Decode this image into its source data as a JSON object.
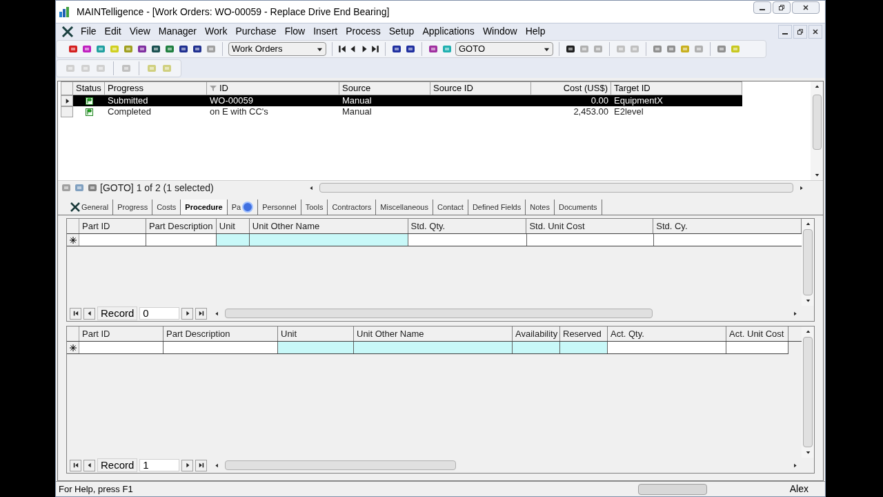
{
  "window": {
    "title": "MAINTelligence - [Work Orders: WO-00059 - Replace Drive End Bearing]"
  },
  "menu": [
    "File",
    "Edit",
    "View",
    "Manager",
    "Work",
    "Purchase",
    "Flow",
    "Insert",
    "Process",
    "Setup",
    "Applications",
    "Window",
    "Help"
  ],
  "toolbar": {
    "module_dropdown": "Work Orders",
    "goto_dropdown": "GOTO"
  },
  "work_orders": {
    "columns": [
      {
        "label": "Status",
        "filtered": false
      },
      {
        "label": "Progress",
        "filtered": false
      },
      {
        "label": "ID",
        "filtered": true
      },
      {
        "label": "Source",
        "filtered": false
      },
      {
        "label": "Source ID",
        "filtered": false
      },
      {
        "label": "Cost (US$)",
        "filtered": false
      },
      {
        "label": "Target ID",
        "filtered": false
      }
    ],
    "rows": [
      {
        "selected": true,
        "progress": "Submitted",
        "id": "WO-00059",
        "source": "Manual",
        "cost": "0.00",
        "target_id": "EquipmentX"
      },
      {
        "selected": false,
        "progress": "Completed",
        "id": "on E with CC's",
        "source": "Manual",
        "cost": "2,453.00",
        "target_id": "E2level"
      }
    ],
    "status": "[GOTO] 1 of 2 (1 selected)"
  },
  "tabs": [
    {
      "label": "General",
      "selected": false
    },
    {
      "label": "Progress",
      "selected": false
    },
    {
      "label": "Costs",
      "selected": false
    },
    {
      "label": "Procedure",
      "selected": true
    },
    {
      "label": "Pa",
      "selected": false
    },
    {
      "label": "Personnel",
      "selected": false
    },
    {
      "label": "Tools",
      "selected": false
    },
    {
      "label": "Contractors",
      "selected": false
    },
    {
      "label": "Miscellaneous",
      "selected": false
    },
    {
      "label": "Contact",
      "selected": false
    },
    {
      "label": "Defined Fields",
      "selected": false
    },
    {
      "label": "Notes",
      "selected": false
    },
    {
      "label": "Documents",
      "selected": false
    }
  ],
  "procedure_grid": {
    "columns": [
      {
        "label": "Part ID",
        "highlighted": false
      },
      {
        "label": "Part Description",
        "highlighted": false
      },
      {
        "label": "Unit",
        "highlighted": true
      },
      {
        "label": "Unit Other Name",
        "highlighted": true
      },
      {
        "label": "Std. Qty.",
        "highlighted": false
      },
      {
        "label": "Std. Unit Cost",
        "highlighted": false
      },
      {
        "label": "Std. Cy.",
        "highlighted": false
      }
    ],
    "record_label": "Record",
    "record_value": "0"
  },
  "parts_grid": {
    "columns": [
      {
        "label": "Part ID",
        "highlighted": false
      },
      {
        "label": "Part Description",
        "highlighted": false
      },
      {
        "label": "Unit",
        "highlighted": true
      },
      {
        "label": "Unit Other Name",
        "highlighted": true
      },
      {
        "label": "Availability",
        "highlighted": true
      },
      {
        "label": "Reserved",
        "highlighted": true
      },
      {
        "label": "Act. Qty.",
        "highlighted": false
      },
      {
        "label": "Act. Unit Cost",
        "highlighted": false
      }
    ],
    "record_label": "Record",
    "record_value": "1"
  },
  "status_bar": {
    "help": "For Help, press F1",
    "user": "Alex"
  }
}
